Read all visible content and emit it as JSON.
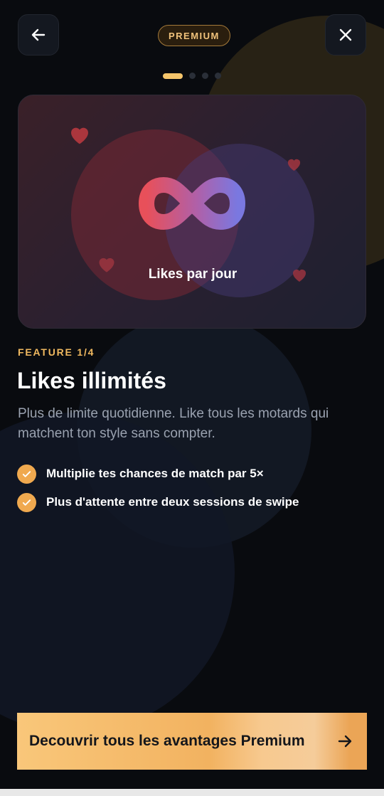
{
  "header": {
    "badge": "PREMIUM",
    "back_icon": "arrow-left-icon",
    "close_icon": "close-icon",
    "page_dots": {
      "total": 4,
      "active": 1
    }
  },
  "hero": {
    "icon": "infinity-icon",
    "caption": "Likes par jour"
  },
  "feature": {
    "label": "FEATURE 1/4",
    "title": "Likes illimités",
    "description": "Plus de limite quotidienne. Like tous les motards qui matchent ton style sans compter.",
    "bullets": [
      "Multiplie tes chances de match par 5×",
      "Plus d'attente entre deux sessions de swipe"
    ]
  },
  "cta": {
    "label": "Decouvrir tous les avantages Premium",
    "icon": "arrow-right-icon"
  },
  "colors": {
    "accent": "#f0a94f",
    "badge_text": "#f0c27b",
    "background": "#090b0f"
  }
}
